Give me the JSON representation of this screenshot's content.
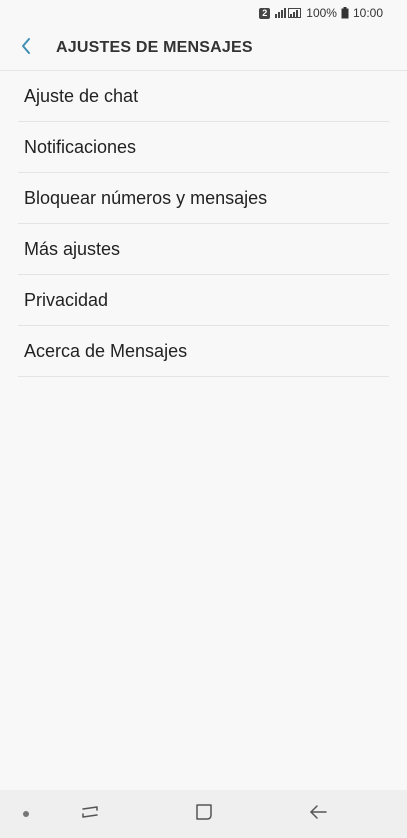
{
  "status_bar": {
    "sim_slot": "2",
    "battery": "100%",
    "time": "10:00"
  },
  "header": {
    "title": "AJUSTES DE MENSAJES"
  },
  "menu": {
    "items": [
      {
        "label": "Ajuste de chat"
      },
      {
        "label": "Notificaciones"
      },
      {
        "label": "Bloquear números y mensajes"
      },
      {
        "label": "Más ajustes"
      },
      {
        "label": "Privacidad"
      },
      {
        "label": "Acerca de Mensajes"
      }
    ]
  },
  "colors": {
    "accent": "#3d8fb3",
    "background": "#f8f8f8"
  },
  "icons": {
    "back": "chevron-left-icon",
    "recent": "recent-apps-icon",
    "home": "home-icon",
    "nav_back": "back-arrow-icon"
  }
}
